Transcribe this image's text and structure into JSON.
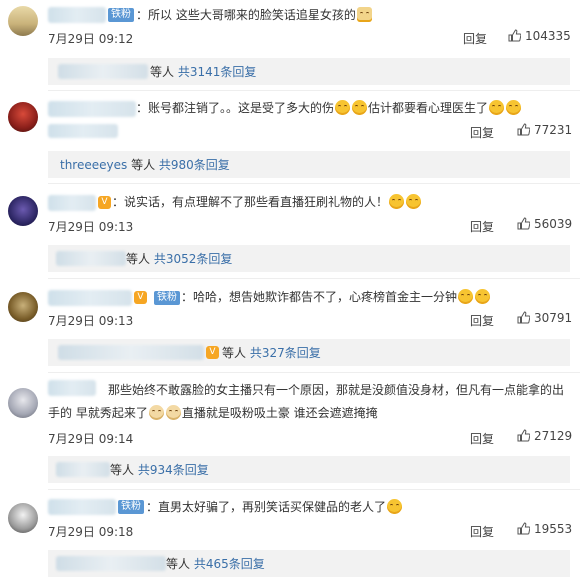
{
  "comments": [
    {
      "badge": "铁粉",
      "text": "：所以 这些大哥哪来的脸笑话追星女孩的",
      "date": "7月29日 09:12",
      "reply": "回复",
      "likes": "104335",
      "sub_tail": "等人",
      "sub_count": "共3141条回复"
    },
    {
      "badge": "",
      "text": "：账号都注销了。。这是受了多大的伤",
      "text2": "估计都要看心理医生了",
      "date": "",
      "reply": "回复",
      "likes": "77231",
      "sub_name": "threeeeyes",
      "sub_tail": " 等人",
      "sub_count": "共980条回复"
    },
    {
      "badge": "",
      "text": "：说实话，有点理解不了那些看直播狂刷礼物的人！",
      "date": "7月29日 09:13",
      "reply": "回复",
      "likes": "56039",
      "sub_tail": "等人",
      "sub_count": "共3052条回复"
    },
    {
      "badge": "铁粉",
      "text": "：哈哈，想告她欺诈都告不了，心疼榜首金主一分钟",
      "date": "7月29日 09:13",
      "reply": "回复",
      "likes": "30791",
      "sub_tail": "等人",
      "sub_count": "共327条回复"
    },
    {
      "badge": "",
      "text": "那些始终不敢露脸的女主播只有一个原因，那就是没颜值没身材，但凡有一点能拿的出",
      "text2": "手的 早就秀起来了",
      "text3": "直播就是吸粉吸土豪  谁还会遮遮掩掩",
      "date": "7月29日 09:14",
      "reply": "回复",
      "likes": "27129",
      "sub_tail": "等人",
      "sub_count": "共934条回复"
    },
    {
      "badge": "铁粉",
      "text": "：直男太好骗了，再别笑话买保健品的老人了",
      "date": "7月29日 09:18",
      "reply": "回复",
      "likes": "19553",
      "sub_tail": "等人",
      "sub_count": "共465条回复"
    }
  ]
}
